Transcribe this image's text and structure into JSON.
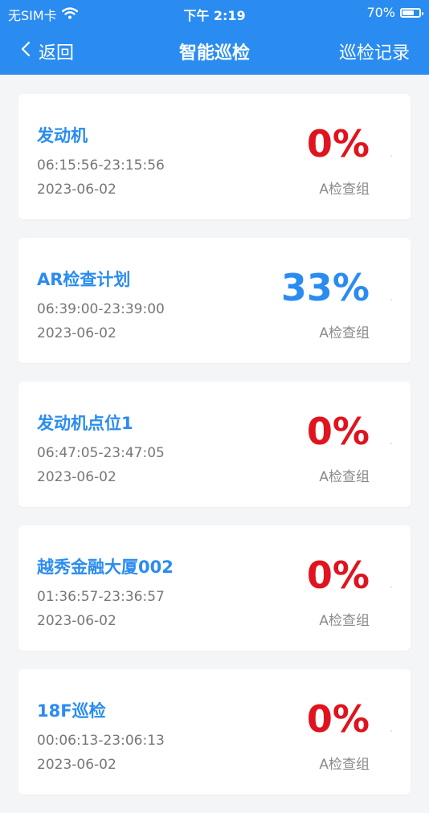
{
  "status_bar": {
    "carrier": "无SIM卡",
    "time": "下午 2:19",
    "battery": "70%",
    "battery_level": 0.7
  },
  "nav": {
    "back_label": "返回",
    "title": "智能巡检",
    "records_label": "巡检记录"
  },
  "colors": {
    "primary": "#2a8cf0",
    "danger": "#e0141e"
  },
  "cards": [
    {
      "name": "发动机",
      "time": "06:15:56-23:15:56",
      "date": "2023-06-02",
      "percent": "0%",
      "group": "A检查组",
      "status": "zero"
    },
    {
      "name": "AR检查计划",
      "time": "06:39:00-23:39:00",
      "date": "2023-06-02",
      "percent": "33%",
      "group": "A检查组",
      "status": "progress"
    },
    {
      "name": "发动机点位1",
      "time": "06:47:05-23:47:05",
      "date": "2023-06-02",
      "percent": "0%",
      "group": "A检查组",
      "status": "zero"
    },
    {
      "name": "越秀金融大厦002",
      "time": "01:36:57-23:36:57",
      "date": "2023-06-02",
      "percent": "0%",
      "group": "A检查组",
      "status": "zero"
    },
    {
      "name": "18F巡检",
      "time": "00:06:13-23:06:13",
      "date": "2023-06-02",
      "percent": "0%",
      "group": "A检查组",
      "status": "zero"
    }
  ]
}
